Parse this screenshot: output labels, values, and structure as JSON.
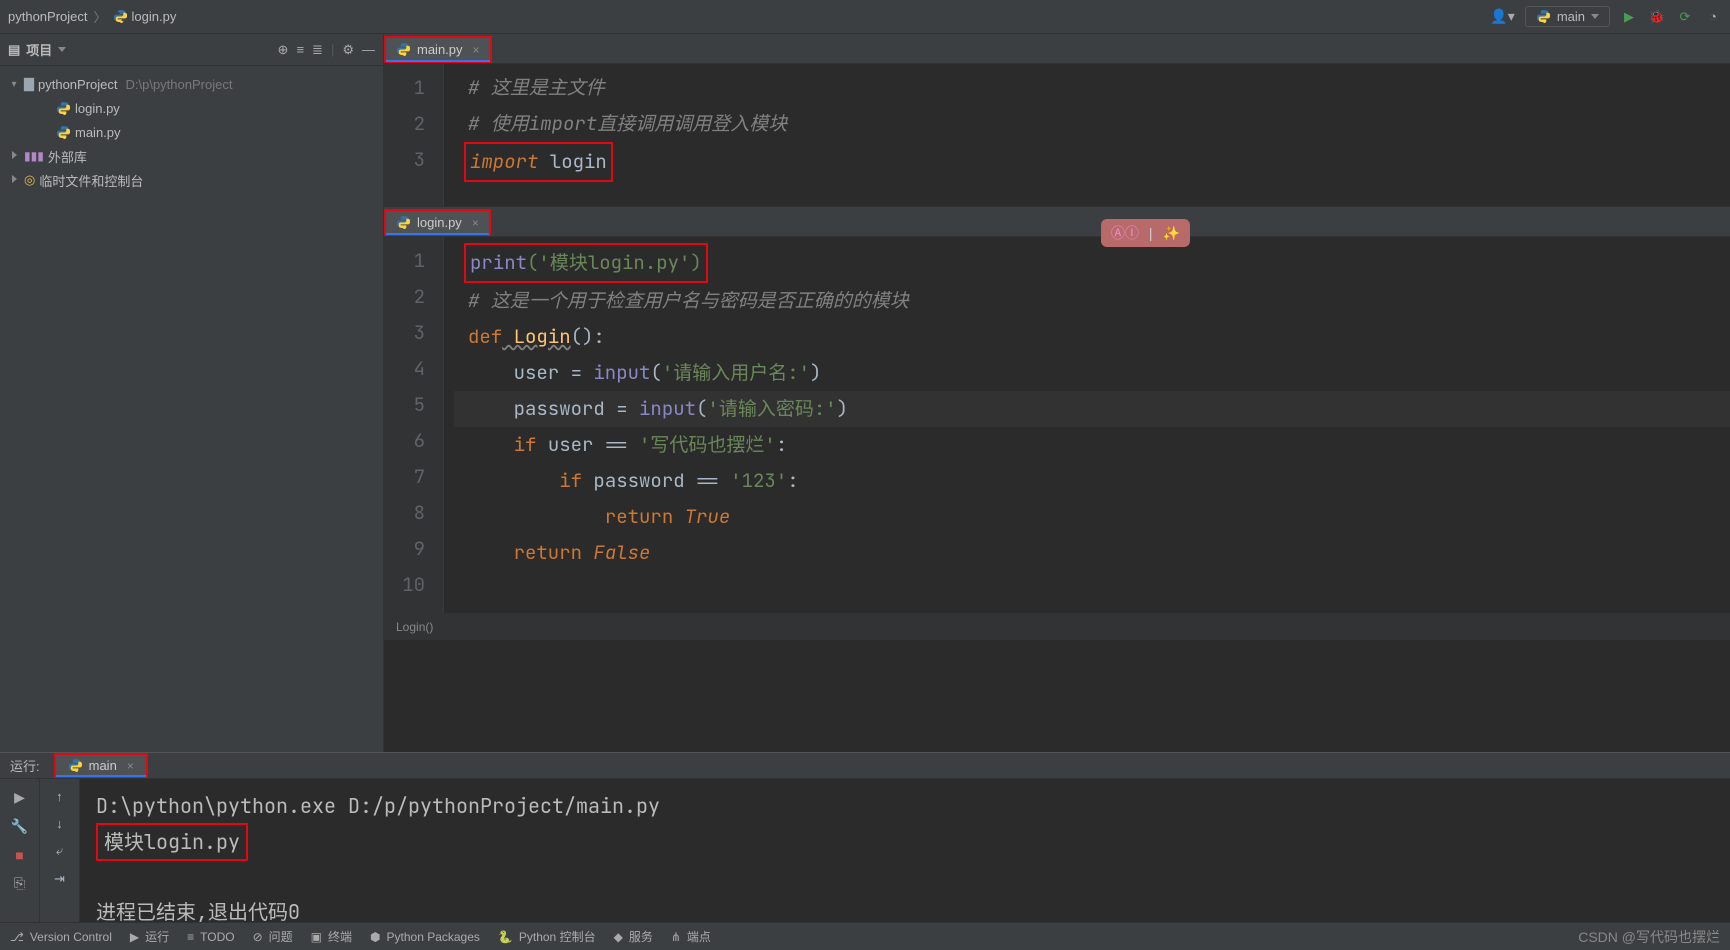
{
  "breadcrumb": {
    "project": "pythonProject",
    "file": "login.py"
  },
  "runConfig": {
    "name": "main"
  },
  "project": {
    "panelTitle": "项目",
    "rootName": "pythonProject",
    "rootPath": "D:\\p\\pythonProject",
    "files": [
      "login.py",
      "main.py"
    ],
    "externalLib": "外部库",
    "scratches": "临时文件和控制台"
  },
  "editors": {
    "main": {
      "tab": "main.py",
      "lines": [
        "1",
        "2",
        "3"
      ],
      "l1_comment": "# 这里是主文件",
      "l2_comment": "# 使用import直接调用调用登入模块",
      "l3_import": "import",
      "l3_mod": " login"
    },
    "login": {
      "tab": "login.py",
      "lines": [
        "1",
        "2",
        "3",
        "4",
        "5",
        "6",
        "7",
        "8",
        "9",
        "10"
      ],
      "l1_print": "print",
      "l1_arg": "('模块login.py')",
      "l2_comment": "# 这是一个用于检查用户名与密码是否正确的的模块",
      "l3_def": "def",
      "l3_name": " Login",
      "l3_paren": "():",
      "l4_a": "    user = ",
      "l4_b": "input",
      "l4_c": "(",
      "l4_d": "'请输入用户名:'",
      "l4_e": ")",
      "l5_a": "    password = ",
      "l5_b": "input",
      "l5_c": "(",
      "l5_d": "'请输入密码:'",
      "l5_e": ")",
      "l6_a": "    ",
      "l6_if": "if",
      "l6_b": " user == ",
      "l6_c": "'写代码也摆烂'",
      "l6_d": ":",
      "l7_a": "        ",
      "l7_if": "if",
      "l7_b": " password == ",
      "l7_c": "'123'",
      "l7_d": ":",
      "l8_a": "            ",
      "l8_ret": "return",
      "l8_b": " True",
      "l9_a": "    ",
      "l9_ret": "return",
      "l9_b": " False",
      "breadcrumb": "Login()"
    }
  },
  "runPanel": {
    "title": "运行:",
    "tab": "main",
    "cmd": "D:\\python\\python.exe D:/p/pythonProject/main.py",
    "out1": "模块login.py",
    "exit": "进程已结束,退出代码0"
  },
  "bottomBar": {
    "vcs": "Version Control",
    "run": "运行",
    "todo": "TODO",
    "problems": "问题",
    "terminal": "终端",
    "pypackages": "Python Packages",
    "pyconsole": "Python 控制台",
    "services": "服务",
    "endpoints": "端点"
  },
  "watermark": "CSDN @写代码也摆烂"
}
